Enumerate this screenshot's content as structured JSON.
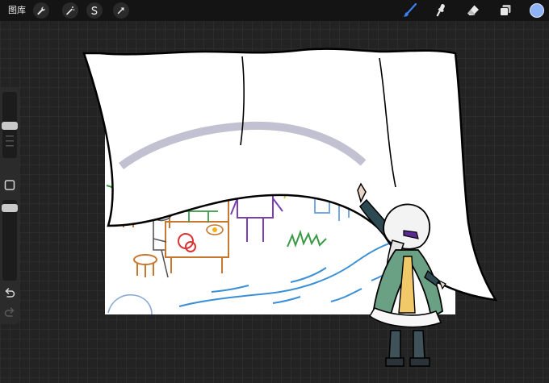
{
  "topbar": {
    "gallery_label": "图库",
    "left_tools": [
      "wrench-icon",
      "magic-wand-icon",
      "selection-s-icon",
      "transform-arrow-icon"
    ],
    "right_tools": [
      "brush-icon",
      "smudge-icon",
      "eraser-icon",
      "layers-icon",
      "color-swatch"
    ],
    "accent_color": "#3b82f6",
    "color_swatch": "#8fb4f5"
  },
  "sidebar": {
    "controls": [
      "brush-size-slider",
      "modify-square-button",
      "opacity-slider",
      "undo-icon",
      "redo-icon"
    ]
  }
}
